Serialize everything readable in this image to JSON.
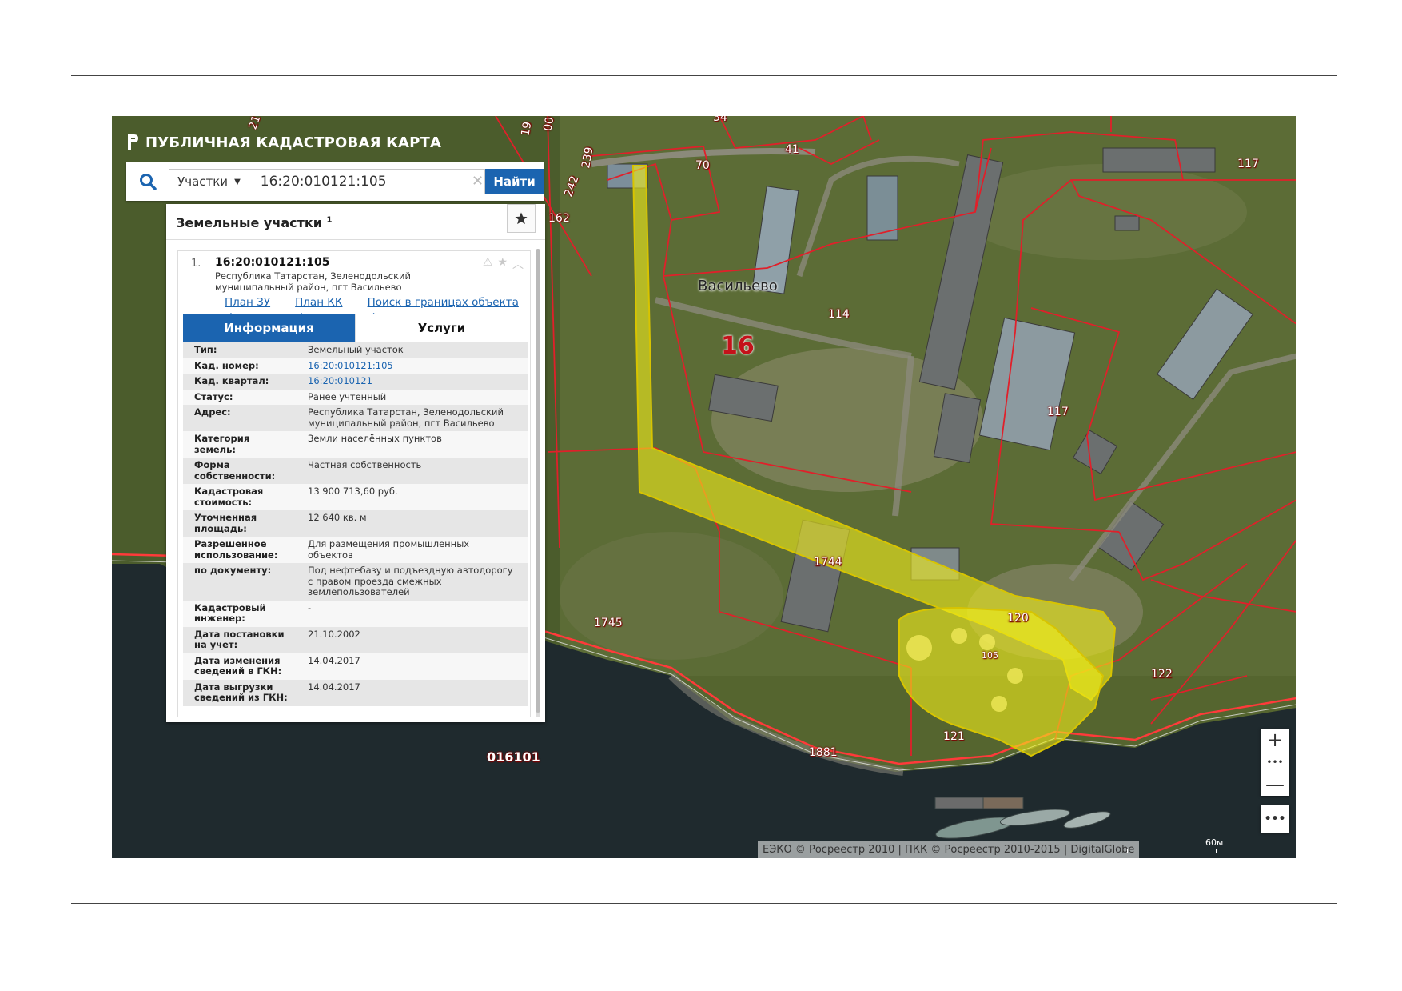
{
  "app": {
    "title": "ПУБЛИЧНАЯ КАДАСТРОВАЯ КАРТА"
  },
  "search": {
    "type_label": "Участки",
    "value": "16:20:010121:105",
    "find_label": "Найти"
  },
  "panel": {
    "title": "Земельные участки",
    "count": "1",
    "item": {
      "number": "1.",
      "cad_number": "16:20:010121:105",
      "address": "Республика Татарстан, Зеленодольский муниципальный район, пгт Васильево",
      "links": [
        "План ЗУ →",
        "План КК →",
        "Поиск в границах объекта →"
      ]
    },
    "tabs": [
      {
        "label": "Информация",
        "active": true
      },
      {
        "label": "Услуги",
        "active": false
      }
    ],
    "rows": [
      {
        "key": "Тип:",
        "value": "Земельный участок"
      },
      {
        "key": "Кад. номер:",
        "value": "16:20:010121:105",
        "link": true
      },
      {
        "key": "Кад. квартал:",
        "value": "16:20:010121",
        "link": true
      },
      {
        "key": "Статус:",
        "value": "Ранее учтенный"
      },
      {
        "key": "Адрес:",
        "value": "Республика Татарстан, Зеленодольский муниципальный район, пгт Васильево"
      },
      {
        "key": "Категория земель:",
        "value": "Земли населённых пунктов"
      },
      {
        "key": "Форма собственности:",
        "value": "Частная собственность"
      },
      {
        "key": "Кадастровая стоимость:",
        "value": "13 900 713,60 руб."
      },
      {
        "key": "Уточненная площадь:",
        "value": "12 640 кв. м"
      },
      {
        "key": "Разрешенное использование:",
        "value": "Для размещения промышленных объектов"
      },
      {
        "key": "по документу:",
        "value": "Под нефтебазу и подъездную автодорогу с правом проезда смежных землепользователей"
      },
      {
        "key": "Кадастровый инженер:",
        "value": "-"
      },
      {
        "key": "Дата постановки на учет:",
        "value": "21.10.2002"
      },
      {
        "key": "Дата изменения сведений в ГКН:",
        "value": "14.04.2017"
      },
      {
        "key": "Дата выгрузки сведений из ГКН:",
        "value": "14.04.2017"
      }
    ]
  },
  "map": {
    "place": "Васильево",
    "quarter": "016101",
    "district": "16",
    "parcel_labels": [
      "21",
      "19",
      "00",
      "34",
      "239",
      "242",
      "162",
      "70",
      "41",
      "117",
      "114",
      "117",
      "1744",
      "1745",
      "120",
      "105",
      "122",
      "121",
      "1881"
    ],
    "attribution": "ЕЭКО © Росреестр 2010 | ПКК © Росреестр 2010-2015 | DigitalGlobe",
    "scale": "60м",
    "colors": {
      "boundary": "#e0202a",
      "selected_fill": "#f2ee1a",
      "water": "#1f2a2e",
      "panel_accent": "#1b64b0"
    }
  },
  "controls": {
    "zoom_in": "+",
    "zoom_dots": "•••",
    "zoom_out": "—",
    "more": "•••"
  }
}
